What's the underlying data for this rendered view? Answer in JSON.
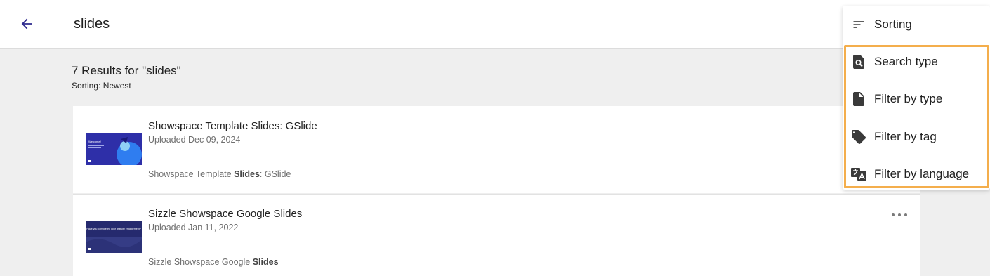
{
  "header": {
    "search_query": "slides"
  },
  "results": {
    "title": "7 Results for \"slides\"",
    "sorting": "Sorting: Newest"
  },
  "cards": [
    {
      "title": "Showspace Template Slides: GSlide",
      "date": "Uploaded Dec 09, 2024",
      "snippet_before": "Showspace Template ",
      "snippet_bold": "Slides",
      "snippet_after": ": GSlide",
      "thumb_text": "Welcome!"
    },
    {
      "title": "Sizzle Showspace Google Slides",
      "date": "Uploaded Jan 11, 2022",
      "snippet_before": "Sizzle Showspace Google ",
      "snippet_bold": "Slides",
      "snippet_after": "",
      "thumb_text": "Have you considered your gratuity engagement?"
    }
  ],
  "menu": {
    "sorting_label": "Sorting",
    "items": [
      {
        "label": "Search type",
        "icon": "search-type-icon"
      },
      {
        "label": "Filter by type",
        "icon": "file-icon"
      },
      {
        "label": "Filter by tag",
        "icon": "tag-icon"
      },
      {
        "label": "Filter by language",
        "icon": "translate-icon"
      }
    ]
  },
  "colors": {
    "accent": "#2f2b8f",
    "highlight": "#f4ae4c"
  }
}
